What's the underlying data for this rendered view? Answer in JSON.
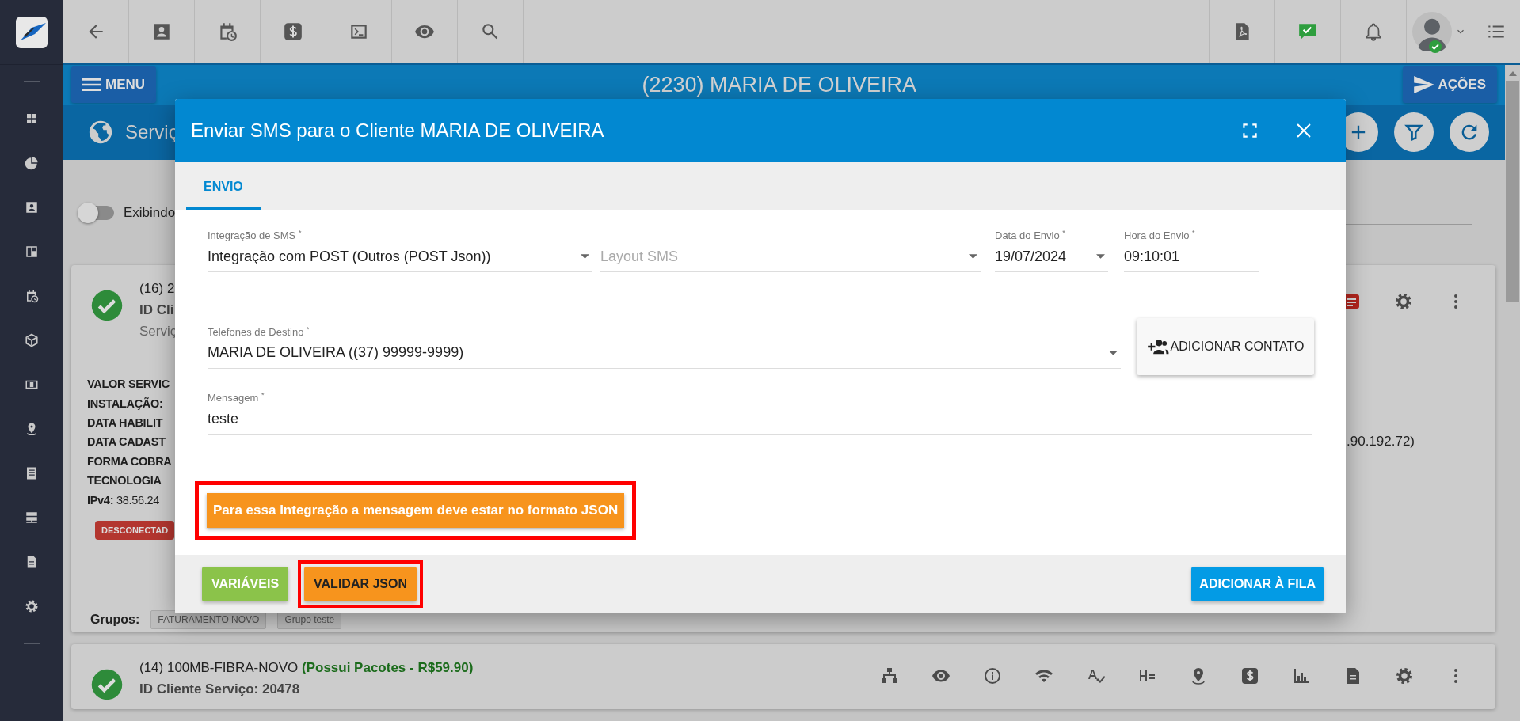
{
  "topbar": {
    "user_online": true
  },
  "header": {
    "menu_button": "MENU",
    "title": "(2230) MARIA DE OLIVEIRA",
    "actions_button": "AÇÕES"
  },
  "section": {
    "title": "Serviç"
  },
  "filter": {
    "toggle_label": "Exibindo",
    "on": false
  },
  "services": [
    {
      "ok": true,
      "title": "(16) 2",
      "client_id": "ID Cli",
      "subtitle": "Serviç",
      "details": [
        {
          "text": "VALOR SERVIC"
        },
        {
          "text": "INSTALAÇÃO:"
        },
        {
          "text": "DATA HABILIT"
        },
        {
          "text": "DATA CADAST",
          "tail": ".90.192.72)"
        },
        {
          "text": "FORMA COBRA"
        },
        {
          "text": "TECNOLOGIA"
        },
        {
          "text": "**IPv4:** 38.56.24"
        }
      ],
      "status": "DESCONECTAD",
      "groups_label": "Grupos:",
      "groups": [
        "FATURAMENTO NOVO",
        "Grupo teste"
      ]
    },
    {
      "ok": true,
      "title": "(14) 100MB-FIBRA-NOVO",
      "note": "(Possui Pacotes - R$59.90)",
      "client_id": "ID Cliente Serviço: 20478"
    }
  ],
  "dialog": {
    "title": "Enviar SMS para o Cliente MARIA DE OLIVEIRA",
    "tabs": [
      {
        "label": "ENVIO",
        "selected": true
      }
    ],
    "rows": [
      {
        "fields": [
          {
            "kind": "select",
            "label": "Integração de SMS $^{*}$",
            "value": "Integração com POST (Outros (POST Json))"
          },
          {
            "kind": "select",
            "placeholder": "Layout SMS"
          },
          {
            "kind": "select",
            "label": "Data do Envio $^{*}$",
            "value": "19/07/2024"
          },
          {
            "kind": "text",
            "label": "Hora do Envio $^{*}$",
            "value": "09:10:01"
          }
        ]
      },
      {
        "fields": [
          {
            "kind": "select",
            "label": "Telefones de Destino $^{*}$",
            "value": "MARIA DE OLIVEIRA ((37) 99999-9999)"
          }
        ],
        "button": "ADICIONAR CONTATO"
      },
      {
        "fields": [
          {
            "kind": "text",
            "label": "Mensagem $^{*}$",
            "value": "teste"
          }
        ]
      }
    ],
    "notice": {
      "text": "Para essa Integração a mensagem deve estar no formato JSON",
      "highlighted": true
    },
    "footer_buttons": [
      {
        "kind": "variables",
        "label": "VARIÁVEIS",
        "highlighted": false
      },
      {
        "kind": "validate",
        "label": "VALIDAR JSON",
        "highlighted": true
      },
      {
        "kind": "submit",
        "label": "ADICIONAR À FILA",
        "highlighted": false
      }
    ]
  }
}
